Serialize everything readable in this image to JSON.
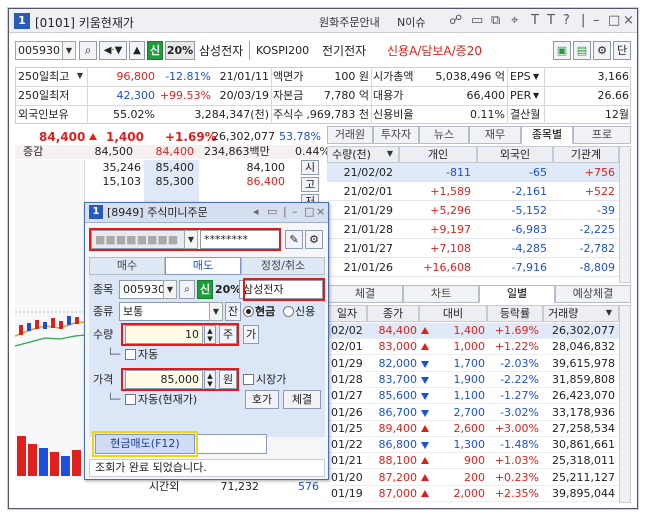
{
  "window": {
    "number": "1",
    "title": "[0101] 키움현재가",
    "menu_order_info": "원화주문안내",
    "menu_news": "N이슈"
  },
  "toolbar": {
    "code": "005930",
    "credit_badge": "신",
    "margin": "20%",
    "stock_name": "삼성전자",
    "index": "KOSPI200",
    "sector": "전기전자",
    "credit_info": "신용A/담보A/증20",
    "single_btn": "단"
  },
  "info_rows": [
    {
      "label": "250일최고",
      "value": "96,800",
      "pct": "-12.81%",
      "date": "21/01/11",
      "label2": "액면가",
      "val2": "100 원",
      "label3": "시가총액",
      "val3": "5,038,496 억",
      "label4": "EPS",
      "val4": "3,166"
    },
    {
      "label": "250일최저",
      "value": "42,300",
      "pct": "+99.53%",
      "date": "20/03/19",
      "label2": "자본금",
      "val2": "7,780 억",
      "label3": "대용가",
      "val3": "66,400",
      "label4": "PER",
      "val4": "26.66"
    },
    {
      "label": "외국인보유",
      "value": "55.02%",
      "pct": "3,284,347(천)",
      "date": "",
      "label2": "주식수",
      "val2": ",969,783 천",
      "label3": "신용비율",
      "val3": "0.11%",
      "label4": "결산월",
      "val4": "12월"
    }
  ],
  "price_bar": {
    "price": "84,400",
    "change": "1,400",
    "pct": "+1.69%",
    "volume": "26,302,077",
    "ratio": "53.78%"
  },
  "quote_header": {
    "label": "증감",
    "p1": "84,500",
    "p2": "84,400",
    "amount": "234,863백만",
    "pct": "0.44%"
  },
  "asks": [
    {
      "qty": "35,246",
      "price": "85,400",
      "side_price": "84,100",
      "side_label": "시"
    },
    {
      "qty": "15,103",
      "price": "85,300",
      "side_price": "86,400",
      "side_label": "고"
    },
    {
      "qty": "",
      "price": "",
      "side_price": "",
      "side_label": "저"
    }
  ],
  "side_btns": [
    "시",
    "고",
    "저"
  ],
  "right_tabs": [
    "거래원",
    "투자자",
    "뉴스",
    "재무",
    "종목별",
    "프로"
  ],
  "investor_header": [
    "수량(천)",
    "개인",
    "외국인",
    "기관계"
  ],
  "investor_rows": [
    {
      "date": "21/02/02",
      "ind": "-811",
      "for": "-65",
      "inst": "+756"
    },
    {
      "date": "21/02/01",
      "ind": "+1,589",
      "for": "-2,161",
      "inst": "+522"
    },
    {
      "date": "21/01/29",
      "ind": "+5,296",
      "for": "-5,152",
      "inst": "-39"
    },
    {
      "date": "21/01/28",
      "ind": "+9,197",
      "for": "-6,983",
      "inst": "-2,225"
    },
    {
      "date": "21/01/27",
      "ind": "+7,108",
      "for": "-4,285",
      "inst": "-2,782"
    },
    {
      "date": "21/01/26",
      "ind": "+16,608",
      "for": "-7,916",
      "inst": "-8,809"
    }
  ],
  "bottom_tabs": [
    "체결",
    "차트",
    "일별",
    "예상체결"
  ],
  "daily_header": [
    "일자",
    "종가",
    "대비",
    "등락률",
    "거래량"
  ],
  "daily_rows": [
    {
      "date": "02/02",
      "close": "84,400",
      "dir": "up",
      "chg": "1,400",
      "rate": "+1.69%",
      "vol": "26,302,077"
    },
    {
      "date": "02/01",
      "close": "83,000",
      "dir": "up",
      "chg": "1,000",
      "rate": "+1.22%",
      "vol": "28,046,832"
    },
    {
      "date": "01/29",
      "close": "82,000",
      "dir": "dn",
      "chg": "1,700",
      "rate": "-2.03%",
      "vol": "39,615,978"
    },
    {
      "date": "01/28",
      "close": "83,700",
      "dir": "dn",
      "chg": "1,900",
      "rate": "-2.22%",
      "vol": "31,859,808"
    },
    {
      "date": "01/27",
      "close": "85,600",
      "dir": "dn",
      "chg": "1,100",
      "rate": "-1.27%",
      "vol": "26,423,070"
    },
    {
      "date": "01/26",
      "close": "86,700",
      "dir": "dn",
      "chg": "2,700",
      "rate": "-3.02%",
      "vol": "33,178,936"
    },
    {
      "date": "01/25",
      "close": "89,400",
      "dir": "up",
      "chg": "2,600",
      "rate": "+3.00%",
      "vol": "27,258,534"
    },
    {
      "date": "01/22",
      "close": "86,800",
      "dir": "dn",
      "chg": "1,300",
      "rate": "-1.48%",
      "vol": "30,861,661"
    },
    {
      "date": "01/21",
      "close": "88,100",
      "dir": "up",
      "chg": "900",
      "rate": "+1.03%",
      "vol": "25,318,011"
    },
    {
      "date": "01/20",
      "close": "87,200",
      "dir": "up",
      "chg": "200",
      "rate": "+0.23%",
      "vol": "25,211,127"
    },
    {
      "date": "01/19",
      "close": "87,000",
      "dir": "up",
      "chg": "2,000",
      "rate": "+2.35%",
      "vol": "39,895,044"
    }
  ],
  "bottom_left": {
    "label": "시간외",
    "value": "71,232",
    "extra": "576"
  },
  "popup": {
    "number": "1",
    "title": "[8949] 주식미니주문",
    "password": "********",
    "tab_buy": "매수",
    "tab_sell": "매도",
    "tab_modify": "정정/취소",
    "label_code": "종목",
    "code": "005930",
    "credit_badge": "신",
    "margin": "20%",
    "stock_name": "삼성전자",
    "label_type": "종류",
    "type_value": "보통",
    "balance_btn": "잔",
    "radio_cash": "현금",
    "radio_credit": "신용",
    "label_qty": "수량",
    "qty": "10",
    "qty_btn": "주",
    "buy_btn": "가",
    "auto_label": "자동",
    "label_price": "가격",
    "price": "85,000",
    "price_unit": "원",
    "market_label": "시장가",
    "auto_cash_label": "자동(현재가)",
    "hoga_btn": "호가",
    "fill_btn": "체결",
    "submit": "현금매도(F12)",
    "status": "조회가 완료 되었습니다."
  }
}
